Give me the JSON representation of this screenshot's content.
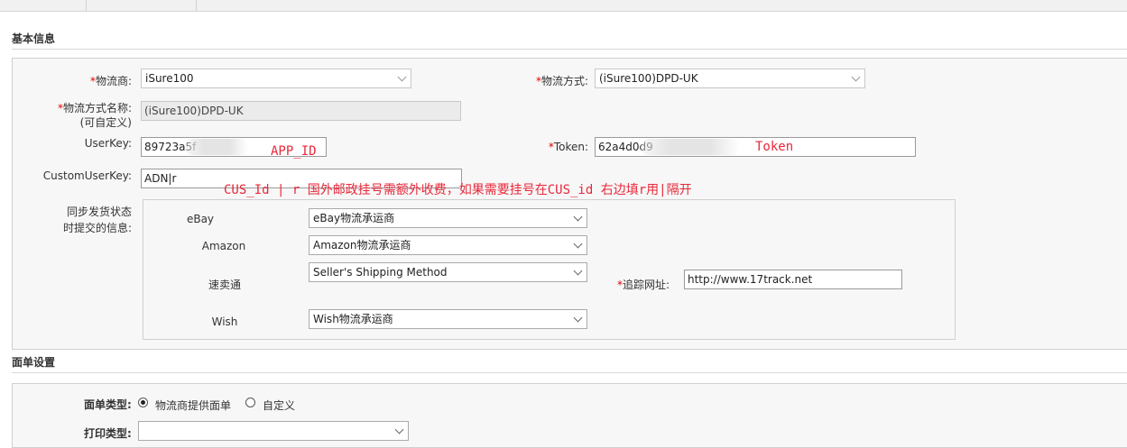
{
  "sections": {
    "basic_info": "基本信息",
    "print_settings": "面单设置"
  },
  "form": {
    "carrier_label": "*物流商:",
    "carrier_value": "iSure100",
    "method_label": "*物流方式:",
    "method_value": "(iSure100)DPD-UK",
    "method_name_label_1": "*物流方式名称:",
    "method_name_label_2": "(可自定义)",
    "method_name_value": "(iSure100)DPD-UK",
    "userkey_label": "UserKey:",
    "userkey_value": "89723a5f",
    "token_label": "*Token:",
    "token_value": "62a4d0d9",
    "customuserkey_label": "CustomUserKey:",
    "customuserkey_value": "ADN|r",
    "sync_label_1": "同步发货状态",
    "sync_label_2": "时提交的信息:"
  },
  "annotations": {
    "app_id": "APP_ID",
    "token": "Token",
    "cus_id": "CUS_Id | r  国外邮政挂号需额外收费，如果需要挂号在CUS_id 右边填r用|隔开"
  },
  "platforms": [
    {
      "label": "eBay",
      "value": "eBay物流承运商"
    },
    {
      "label": "Amazon",
      "value": "Amazon物流承运商"
    },
    {
      "label": "速卖通",
      "value": "Seller's Shipping Method"
    },
    {
      "label": "Wish",
      "value": "Wish物流承运商"
    }
  ],
  "tracking": {
    "label": "* 追踪网址:",
    "value": "http://www.17track.net"
  },
  "print": {
    "type_label": "面单类型:",
    "option_carrier": "物流商提供面单",
    "option_custom": "自定义",
    "print_type_label": "打印类型:",
    "print_type_value": ""
  }
}
